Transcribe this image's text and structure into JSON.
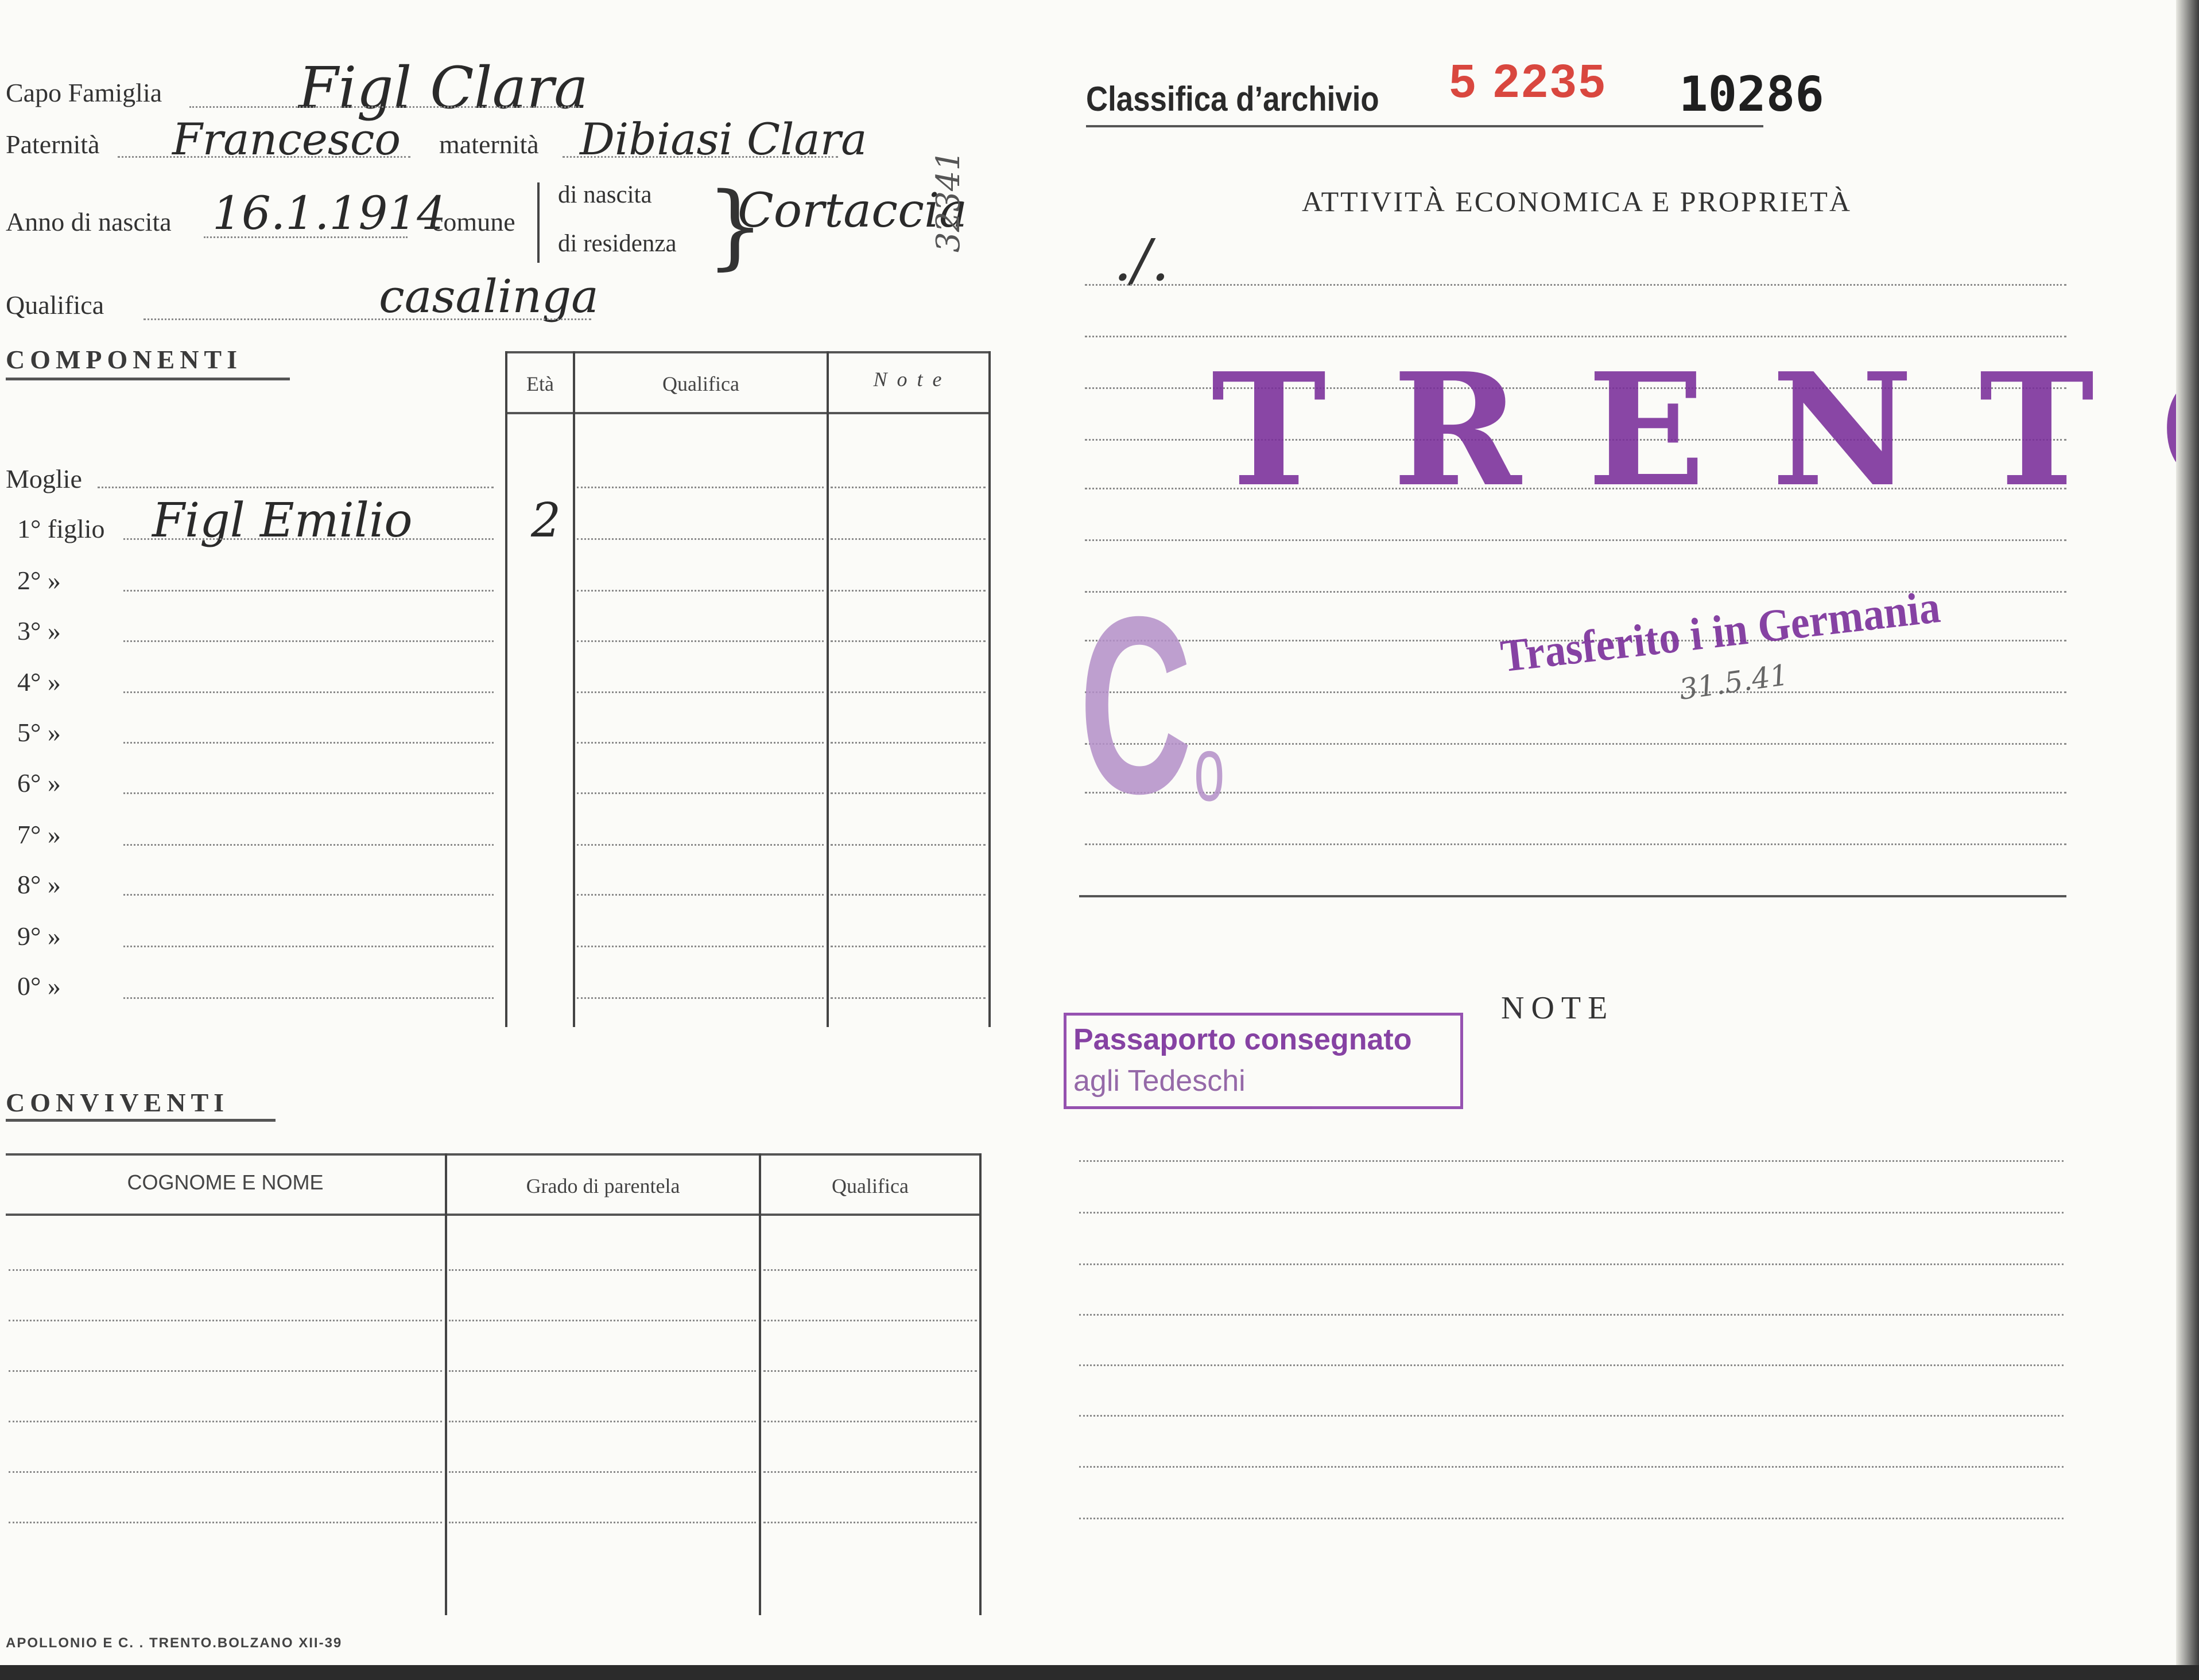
{
  "header": {
    "capo_famiglia_label": "Capo Famiglia",
    "capo_famiglia_value": "Figl Clara",
    "paternita_label": "Paternità",
    "paternita_value": "Francesco",
    "maternita_label": "maternità",
    "maternita_value": "Dibiasi Clara",
    "anno_nascita_label": "Anno di nascita",
    "anno_nascita_value": "16.1.1914",
    "comune_label": "comune",
    "di_nascita_label": "di nascita",
    "di_residenza_label": "di residenza",
    "comune_value": "Cortaccia",
    "margin_number": "32341",
    "qualifica_label": "Qualifica",
    "qualifica_value": "casalinga"
  },
  "componenti": {
    "title": "COMPONENTI",
    "columns": [
      "Età",
      "Qualifica",
      "N o t e"
    ],
    "rows": [
      {
        "label": "Moglie",
        "name": "",
        "eta": ""
      },
      {
        "label": "1° figlio",
        "name": "Figl Emilio",
        "eta": "2"
      },
      {
        "label": "2°  »",
        "name": "",
        "eta": ""
      },
      {
        "label": "3°  »",
        "name": "",
        "eta": ""
      },
      {
        "label": "4°  »",
        "name": "",
        "eta": ""
      },
      {
        "label": "5°  »",
        "name": "",
        "eta": ""
      },
      {
        "label": "6°  »",
        "name": "",
        "eta": ""
      },
      {
        "label": "7°  »",
        "name": "",
        "eta": ""
      },
      {
        "label": "8°  »",
        "name": "",
        "eta": ""
      },
      {
        "label": "9°  »",
        "name": "",
        "eta": ""
      },
      {
        "label": "0°  »",
        "name": "",
        "eta": ""
      }
    ]
  },
  "conviventi": {
    "title": "CONVIVENTI",
    "columns": [
      "COGNOME E NOME",
      "Grado di parentela",
      "Qualifica"
    ]
  },
  "footer": {
    "printer": "APOLLONIO E C. . TRENTO.BOLZANO XII-39"
  },
  "archivio": {
    "label": "Classifica  d’archivio",
    "red_number": "5 2235",
    "black_number": "10286"
  },
  "attivita": {
    "title": "ATTIVITÀ ECONOMICA E PROPRIETÀ",
    "mark": "./."
  },
  "stamps": {
    "trento": "TRENTO",
    "co_big": "C",
    "co_small": "o",
    "trasferito": "Trasferito i in Germania",
    "trasferito_date": "31.5.41",
    "passaporto_line1": "Passaporto consegnato",
    "passaporto_line2": "agli      Tedeschi"
  },
  "note": {
    "title": "NOTE"
  },
  "colors": {
    "stamp_purple": "#7a2e9a",
    "red_number": "#d9473f"
  }
}
